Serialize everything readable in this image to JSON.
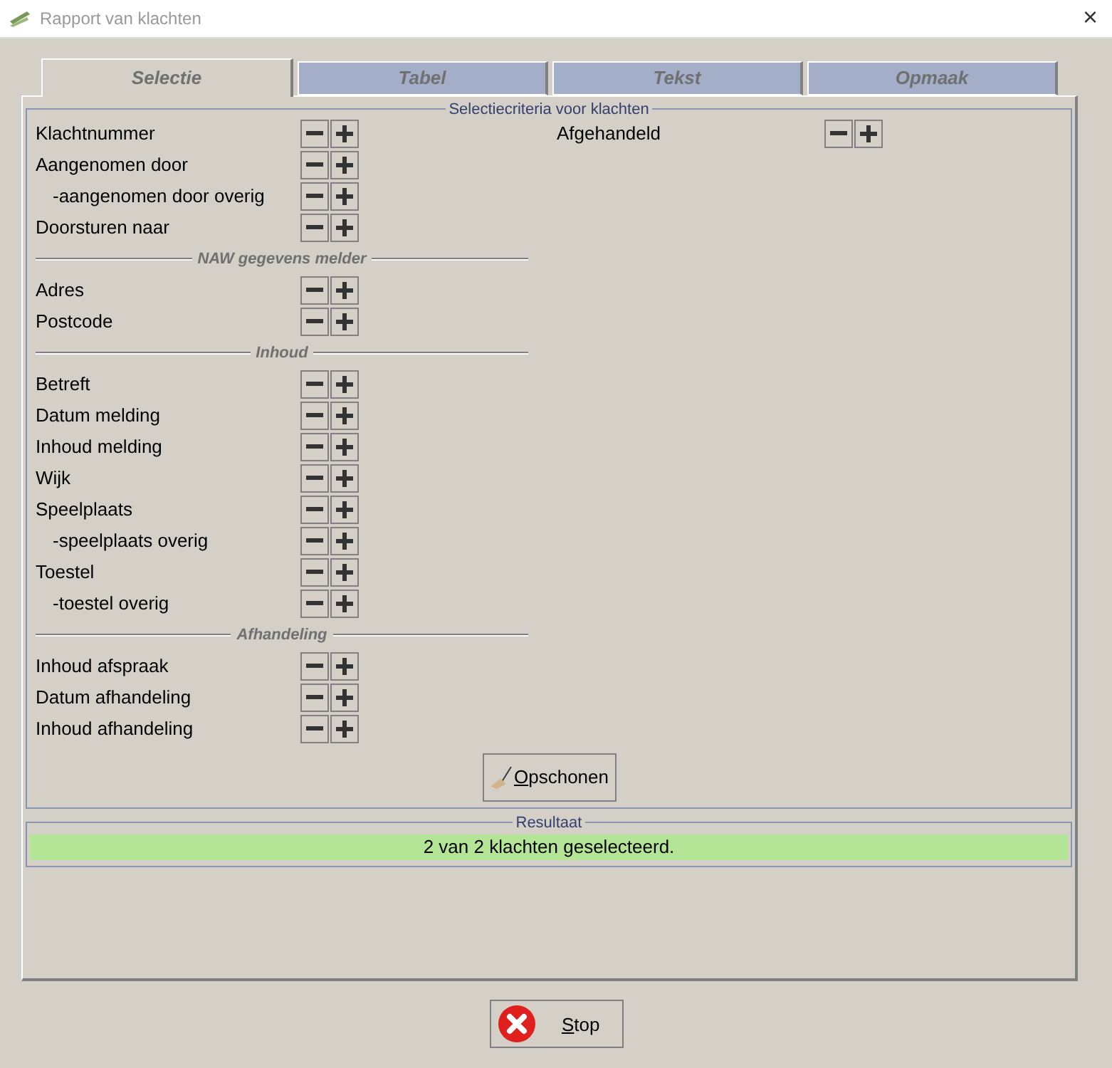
{
  "window": {
    "title": "Rapport van klachten",
    "close": "×"
  },
  "tabs": [
    {
      "label": "Selectie",
      "selected": true
    },
    {
      "label": "Tabel",
      "selected": false
    },
    {
      "label": "Tekst",
      "selected": false
    },
    {
      "label": "Opmaak",
      "selected": false
    }
  ],
  "criteria": {
    "title": "Selectiecriteria voor klachten",
    "left": [
      {
        "kind": "row",
        "label": "Klachtnummer"
      },
      {
        "kind": "row",
        "label": "Aangenomen door",
        "children": [
          {
            "kind": "row",
            "label": "-aangenomen door overig"
          }
        ]
      },
      {
        "kind": "row",
        "label": "Doorsturen naar"
      },
      {
        "kind": "section",
        "label": "NAW gegevens melder"
      },
      {
        "kind": "row",
        "label": "Adres"
      },
      {
        "kind": "row",
        "label": "Postcode"
      },
      {
        "kind": "section",
        "label": "Inhoud"
      },
      {
        "kind": "row",
        "label": "Betreft"
      },
      {
        "kind": "row",
        "label": "Datum melding"
      },
      {
        "kind": "row",
        "label": "Inhoud melding"
      },
      {
        "kind": "row",
        "label": "Wijk"
      },
      {
        "kind": "row",
        "label": "Speelplaats",
        "children": [
          {
            "kind": "row",
            "label": "-speelplaats overig"
          }
        ]
      },
      {
        "kind": "row",
        "label": "Toestel",
        "children": [
          {
            "kind": "row",
            "label": "-toestel overig"
          }
        ]
      },
      {
        "kind": "section",
        "label": "Afhandeling"
      },
      {
        "kind": "row",
        "label": "Inhoud afspraak"
      },
      {
        "kind": "row",
        "label": "Datum afhandeling"
      },
      {
        "kind": "row",
        "label": "Inhoud afhandeling"
      }
    ],
    "right": [
      {
        "kind": "row",
        "label": "Afgehandeld"
      }
    ],
    "clear_button": {
      "label": "Opschonen",
      "first_letter_underlined": true
    }
  },
  "result": {
    "title": "Resultaat",
    "message": "2 van 2 klachten geselecteerd."
  },
  "stop_button": {
    "label": "Stop",
    "first_letter_underlined": true
  }
}
